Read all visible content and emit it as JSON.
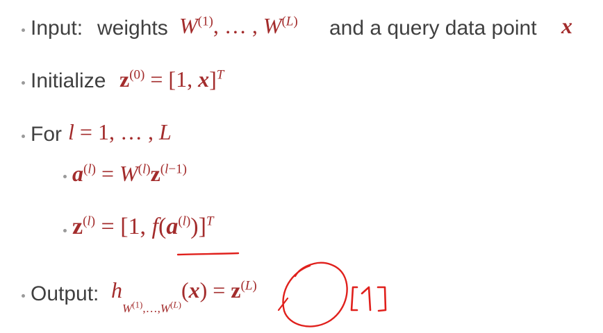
{
  "slide": {
    "lines": [
      {
        "bullet_label": "Input:",
        "text_1": "weights",
        "math_1": "W(1), … , W(L)",
        "text_2": "and a query data point",
        "math_2": "x"
      },
      {
        "text_1": "Initialize",
        "math_1": "z(0) = [1, x]T"
      },
      {
        "text_1": "For",
        "math_1": "l = 1, … , L"
      },
      {
        "math_1": "a(l) = W(l)z(l−1)"
      },
      {
        "math_1": "z(l) = [1, f(a(l))]T"
      },
      {
        "text_1": "Output:",
        "math_1": "hW(1),…,W(L)(x) = z(L)",
        "handwritten": "[1]"
      }
    ]
  },
  "colors": {
    "text": "#404040",
    "math": "#a32c2c",
    "annotation": "#e0201c",
    "bullet": "#9a9a9a"
  }
}
